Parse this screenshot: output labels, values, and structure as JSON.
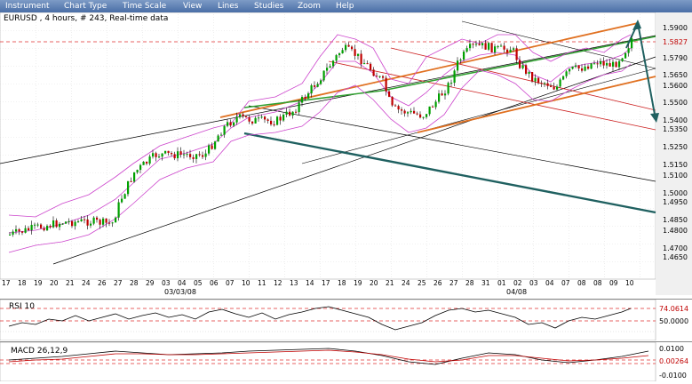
{
  "menu": [
    "Instrument",
    "Chart Type",
    "Time Scale",
    "View",
    "Lines",
    "Studies",
    "Zoom",
    "Help"
  ],
  "main": {
    "title": "EURUSD , 4 hours, # 243, Real-time data",
    "y_labels": [
      "1.5900",
      "1.5827",
      "1.5790",
      "1.5650",
      "1.5600",
      "1.5500",
      "1.5400",
      "1.5350",
      "1.5250",
      "1.5150",
      "1.5100",
      "1.5000",
      "1.4950",
      "1.4850",
      "1.4800",
      "1.4700",
      "1.4650"
    ],
    "current_price": "1.5827",
    "x_labels": [
      "17",
      "18",
      "19",
      "20",
      "21",
      "24",
      "26",
      "27",
      "28",
      "29",
      "03",
      "04",
      "05",
      "06",
      "07",
      "10",
      "11",
      "12",
      "13",
      "14",
      "17",
      "18",
      "19",
      "20",
      "21",
      "24",
      "25",
      "26",
      "27",
      "28",
      "31",
      "01",
      "02",
      "03",
      "04",
      "07",
      "08",
      "08",
      "09",
      "10"
    ],
    "month_labels": [
      "03/03/08",
      "04/08"
    ]
  },
  "rsi": {
    "title": "RSI 10",
    "y_labels": [
      "74.0614",
      "50.0000"
    ]
  },
  "macd": {
    "title": "MACD 26,12,9",
    "y_labels": [
      "0.0100",
      "0.00264",
      "-0.0100"
    ]
  },
  "colors": {
    "menubar": "#4a6ea6",
    "up_candle": "#00a000",
    "down_candle": "#c00000",
    "bollinger": "#cc44cc",
    "orange_channel": "#e07020",
    "green_line": "#30a030",
    "teal_line": "#1f6060",
    "red_channel": "#cc2020",
    "dashed_level": "#e03030"
  }
}
